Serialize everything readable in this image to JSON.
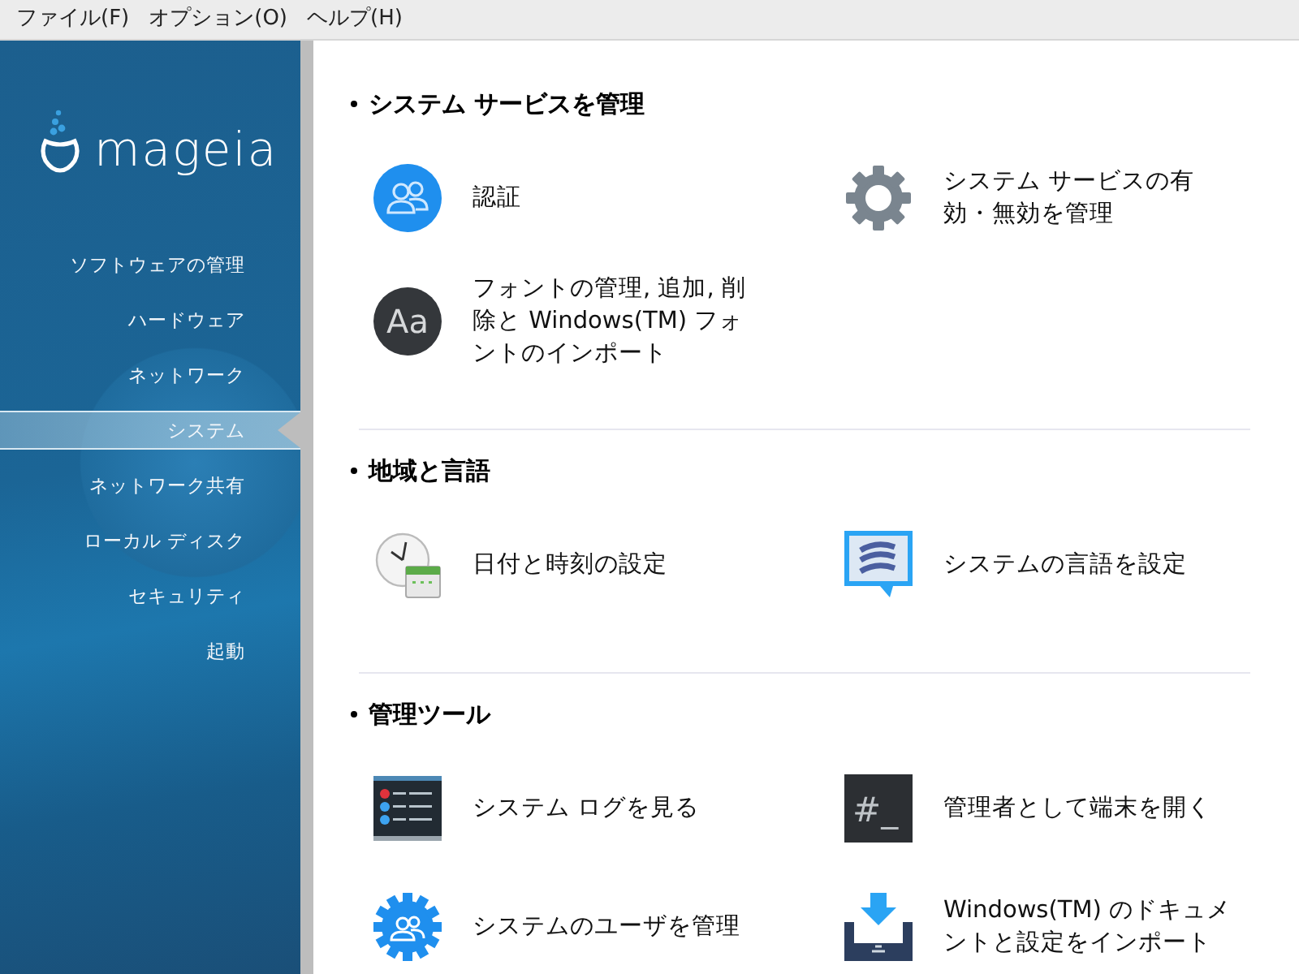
{
  "menu_bar": [
    {
      "label": "ファイル(F)"
    },
    {
      "label": "オプション(O)"
    },
    {
      "label": "ヘルプ(H)"
    }
  ],
  "sidebar": {
    "logo": "mageia",
    "items": [
      {
        "label": "ソフトウェアの管理",
        "selected": false
      },
      {
        "label": "ハードウェア",
        "selected": false
      },
      {
        "label": "ネットワーク",
        "selected": false
      },
      {
        "label": "システム",
        "selected": true
      },
      {
        "label": "ネットワーク共有",
        "selected": false
      },
      {
        "label": "ローカル ディスク",
        "selected": false
      },
      {
        "label": "セキュリティ",
        "selected": false
      },
      {
        "label": "起動",
        "selected": false
      }
    ]
  },
  "sections": [
    {
      "title": "システム サービスを管理",
      "items": [
        {
          "kind": "users",
          "label": "認証"
        },
        {
          "kind": "gear",
          "label": "システム サービスの有効・無効を管理"
        },
        {
          "kind": "font",
          "glyph": "Aa",
          "label": "フォントの管理, 追加, 削除と Windows(TM) フォントのインポート"
        }
      ]
    },
    {
      "title": "地域と言語",
      "items": [
        {
          "kind": "clock",
          "label": "日付と時刻の設定"
        },
        {
          "kind": "language",
          "label": "システムの言語を設定"
        }
      ]
    },
    {
      "title": "管理ツール",
      "items": [
        {
          "kind": "log",
          "label": "システム ログを見る"
        },
        {
          "kind": "terminal",
          "glyph": "#_",
          "label": "管理者として端末を開く"
        },
        {
          "kind": "usergear",
          "label": "システムのユーザを管理"
        },
        {
          "kind": "import",
          "label": "Windows(TM) のドキュメントと設定をインポート"
        }
      ]
    }
  ]
}
